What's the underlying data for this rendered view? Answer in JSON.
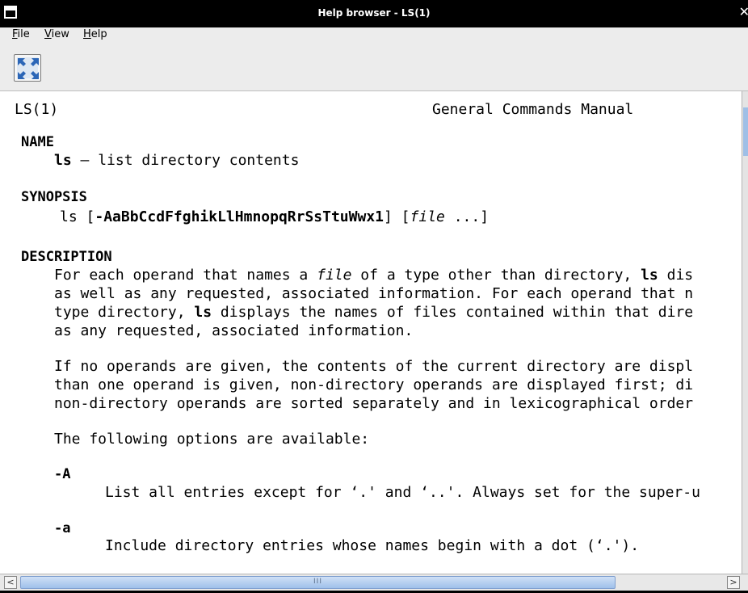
{
  "window": {
    "title": "Help browser - LS(1)"
  },
  "menubar": {
    "items": [
      {
        "first": "F",
        "rest": "ile"
      },
      {
        "first": "V",
        "rest": "iew"
      },
      {
        "first": "H",
        "rest": "elp"
      }
    ]
  },
  "toolbar": {
    "fullscreen_icon": "fullscreen-icon"
  },
  "man": {
    "header_left": "LS(1)",
    "header_center": "General Commands Manual",
    "name_heading": "NAME",
    "name_cmd": "ls",
    "name_desc": " – list directory contents",
    "synopsis_heading": "SYNOPSIS",
    "synopsis_cmd": "ls",
    "synopsis_open": " [",
    "synopsis_flags": "-AaBbCcdFfghikLlHmnopqRrSsTtuWwx1",
    "synopsis_close": "] [",
    "synopsis_file": "file",
    "synopsis_end": " ...]",
    "description_heading": "DESCRIPTION",
    "desc_p1_l1_a": "For each operand that names a ",
    "desc_p1_l1_file": "file",
    "desc_p1_l1_b": " of a type other than directory, ",
    "desc_p1_l1_ls": "ls",
    "desc_p1_l1_c": " dis",
    "desc_p1_l2": "as well as any requested, associated information. For each operand that n",
    "desc_p1_l3_a": "type directory, ",
    "desc_p1_l3_ls": "ls",
    "desc_p1_l3_b": " displays the names of files contained within that dire",
    "desc_p1_l4": "as any requested, associated information.",
    "desc_p2_l1": "If no operands are given, the contents of the current directory are displ",
    "desc_p2_l2": "than one operand is given, non-directory operands are displayed first; di",
    "desc_p2_l3": "non-directory operands are sorted separately and in lexicographical order",
    "desc_p3": "The following options are available:",
    "opt_A": "-A",
    "opt_A_desc": "List all entries except for ‘.' and ‘..'. Always set for the super-u",
    "opt_a": "-a",
    "opt_a_desc": "Include directory entries whose names begin with a dot (‘.')."
  },
  "scrollbar": {
    "grip": "III"
  }
}
